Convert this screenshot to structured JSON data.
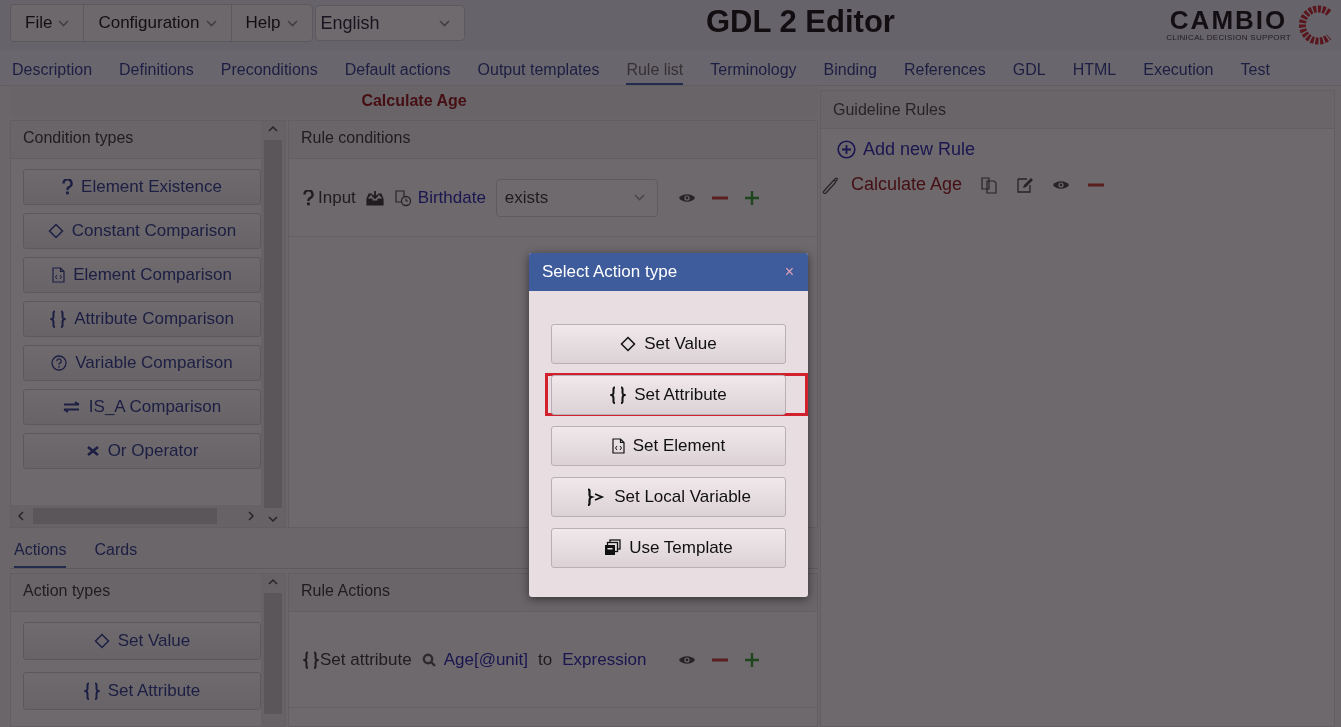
{
  "menu": [
    {
      "label": "File"
    },
    {
      "label": "Configuration"
    },
    {
      "label": "Help"
    }
  ],
  "language": "English",
  "title": "GDL 2 Editor",
  "logo": {
    "name": "CAMBIO",
    "tagline": "CLINICAL DECISION SUPPORT"
  },
  "tabs": [
    {
      "label": "Description",
      "selected": false
    },
    {
      "label": "Definitions",
      "selected": false
    },
    {
      "label": "Preconditions",
      "selected": false
    },
    {
      "label": "Default actions",
      "selected": false
    },
    {
      "label": "Output templates",
      "selected": false
    },
    {
      "label": "Rule list",
      "selected": true
    },
    {
      "label": "Terminology",
      "selected": false
    },
    {
      "label": "Binding",
      "selected": false
    },
    {
      "label": "References",
      "selected": false
    },
    {
      "label": "GDL",
      "selected": false
    },
    {
      "label": "HTML",
      "selected": false
    },
    {
      "label": "Execution",
      "selected": false
    },
    {
      "label": "Test",
      "selected": false
    }
  ],
  "rule_title": "Calculate Age",
  "condition_types": {
    "title": "Condition types",
    "items": [
      {
        "kind": "existence",
        "label": "Element Existence"
      },
      {
        "kind": "constant",
        "label": "Constant Comparison"
      },
      {
        "kind": "element",
        "label": "Element Comparison"
      },
      {
        "kind": "attribute",
        "label": "Attribute Comparison"
      },
      {
        "kind": "variable",
        "label": "Variable Comparison"
      },
      {
        "kind": "is_a",
        "label": "IS_A Comparison"
      },
      {
        "kind": "or",
        "label": "Or Operator"
      }
    ]
  },
  "rule_conditions": {
    "title": "Rule conditions",
    "rows": [
      {
        "prefix": "Input",
        "element": "Birthdate",
        "operator": "exists"
      }
    ]
  },
  "bottom_tabs": [
    {
      "label": "Actions",
      "selected": true
    },
    {
      "label": "Cards",
      "selected": false
    }
  ],
  "action_types": {
    "title": "Action types",
    "items": [
      {
        "kind": "value",
        "label": "Set Value"
      },
      {
        "kind": "attribute",
        "label": "Set Attribute"
      }
    ]
  },
  "rule_actions": {
    "title": "Rule Actions",
    "rows": [
      {
        "label": "Set attribute",
        "target": "Age[@unit]",
        "connector": "to",
        "value": "Expression"
      }
    ]
  },
  "guideline_rules": {
    "title": "Guideline Rules",
    "add_label": "Add new Rule",
    "rules": [
      {
        "name": "Calculate Age"
      }
    ]
  },
  "dialog": {
    "title": "Select Action type",
    "close": "×",
    "options": [
      {
        "kind": "value",
        "label": "Set Value",
        "highlighted": false
      },
      {
        "kind": "attribute",
        "label": "Set Attribute",
        "highlighted": true
      },
      {
        "kind": "element",
        "label": "Set Element",
        "highlighted": false
      },
      {
        "kind": "local",
        "label": "Set Local Variable",
        "highlighted": false
      },
      {
        "kind": "template",
        "label": "Use Template",
        "highlighted": false
      }
    ]
  }
}
